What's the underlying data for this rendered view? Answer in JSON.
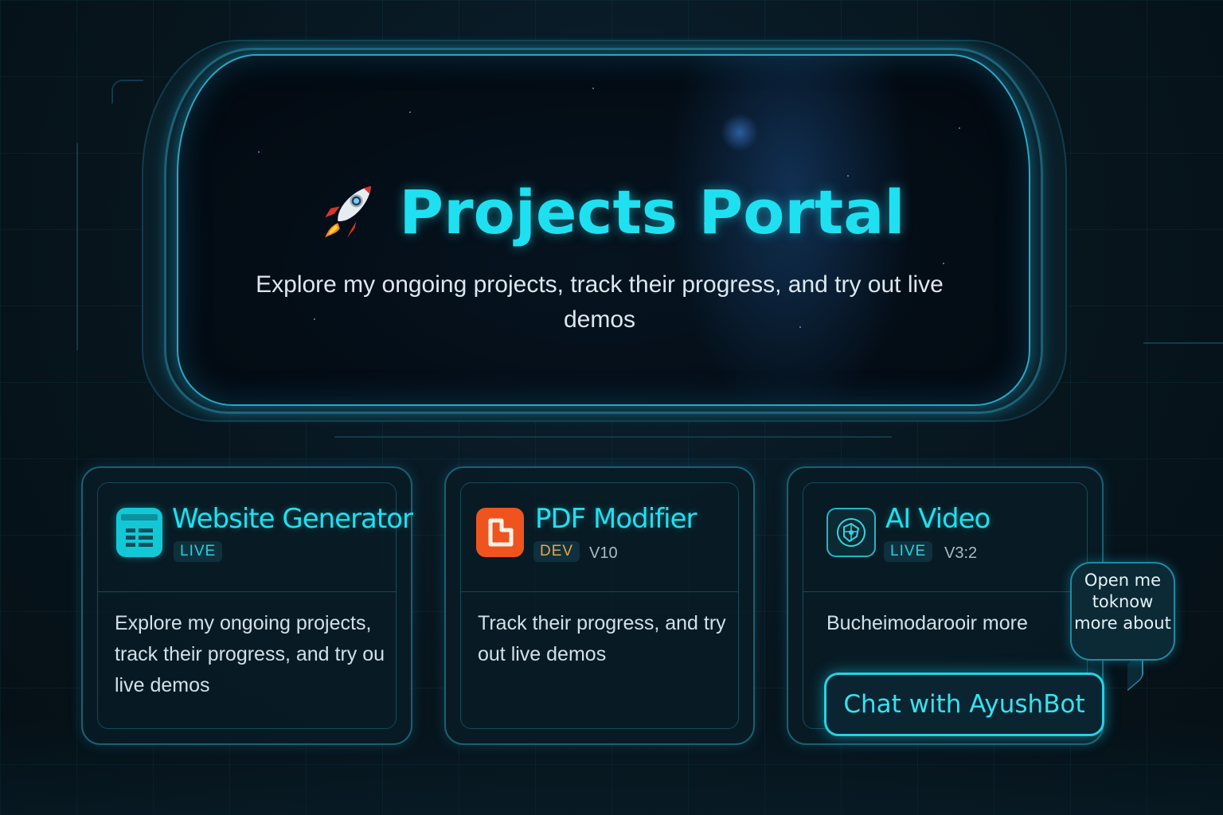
{
  "hero": {
    "title": "Projects Portal",
    "subtitle": "Explore my ongoing projects, track their progress, and try out live demos",
    "icon": "rocket-icon"
  },
  "colors": {
    "accent": "#1fe0f0",
    "background": "#07151d",
    "live": "#1fd3e3",
    "dev": "#f0a43a",
    "pdf_icon": "#f0541e"
  },
  "cards": [
    {
      "title": "Website Generator",
      "status": "LIVE",
      "version": "",
      "icon": "website-layout-icon",
      "description": "Explore my ongoing projects, track their progress, and try ou live demos"
    },
    {
      "title": "PDF Modifier",
      "status": "DEV",
      "version": "V10",
      "icon": "pdf-document-icon",
      "description": "Track their progress, and try out live demos"
    },
    {
      "title": "AI Video",
      "status": "LIVE",
      "version": "V3:2",
      "icon": "ai-brain-icon",
      "description": "Bucheimodarooir more"
    }
  ],
  "chat": {
    "button_label": "Chat with AyushBot",
    "bubble_text": "Open me toknow more about"
  }
}
